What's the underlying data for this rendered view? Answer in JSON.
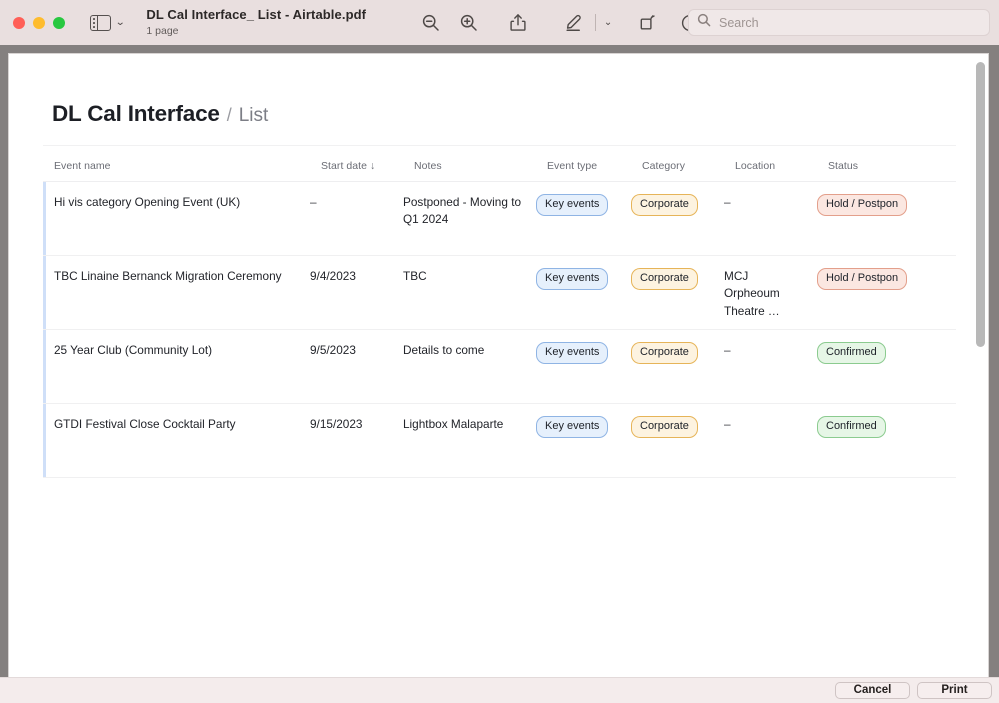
{
  "window": {
    "title": "DL Cal Interface_ List - Airtable.pdf",
    "subtitle": "1 page",
    "traffic_lights": [
      "close-red",
      "minimize-yellow",
      "maximize-green"
    ],
    "sidebar_toggle_icon": "sidebar-icon",
    "sidebar_chevron_icon": "chevron-down-icon"
  },
  "toolbar": {
    "zoom_out_icon": "zoom-out-icon",
    "zoom_in_icon": "zoom-in-icon",
    "share_icon": "share-icon",
    "markup_icon": "markup-pen-icon",
    "markup_chevron_icon": "chevron-down-icon",
    "rotate_icon": "rotate-icon",
    "highlight_icon": "highlight-pen-icon"
  },
  "search": {
    "placeholder": "Search",
    "value": "",
    "icon": "search-icon"
  },
  "document": {
    "breadcrumb": {
      "base": "DL Cal Interface",
      "separator": "/",
      "current": "List"
    },
    "table": {
      "columns": [
        {
          "key": "event_name",
          "label": "Event name"
        },
        {
          "key": "start_date",
          "label": "Start date ↓"
        },
        {
          "key": "notes",
          "label": "Notes"
        },
        {
          "key": "event_type",
          "label": "Event type"
        },
        {
          "key": "category",
          "label": "Category"
        },
        {
          "key": "location",
          "label": "Location"
        },
        {
          "key": "status",
          "label": "Status"
        }
      ],
      "sort_column": "Start date",
      "sort_direction": "descending",
      "rows": [
        {
          "event_name": "Hi vis category Opening Event (UK)",
          "start_date": "–",
          "notes": "Postponed - Moving to Q1 2024",
          "event_type": "Key events",
          "category": "Corporate",
          "location": "–",
          "status": "Hold / Postpon"
        },
        {
          "event_name": "TBC Linaine Bernanck Migration Ceremony",
          "start_date": "9/4/2023",
          "notes": "TBC",
          "event_type": "Key events",
          "category": "Corporate",
          "location": "MCJ Orpheoum Theatre …",
          "status": "Hold / Postpon"
        },
        {
          "event_name": "25 Year Club (Community Lot)",
          "start_date": "9/5/2023",
          "notes": "Details to come",
          "event_type": "Key events",
          "category": "Corporate",
          "location": "–",
          "status": "Confirmed"
        },
        {
          "event_name": "GTDI Festival Close Cocktail Party",
          "start_date": "9/15/2023",
          "notes": "Lightbox Malaparte",
          "event_type": "Key events",
          "category": "Corporate",
          "location": "–",
          "status": "Confirmed"
        }
      ]
    }
  },
  "footer": {
    "cancel_label": "Cancel",
    "print_label": "Print"
  },
  "colors": {
    "badge_blue": "#e6f0fc",
    "badge_blue_border": "#8fb4e4",
    "badge_orange": "#fdf3e0",
    "badge_orange_border": "#e6b458",
    "badge_red": "#fbe7e1",
    "badge_red_border": "#e39f8b",
    "badge_green": "#e6f6e6",
    "badge_green_border": "#8bcb8f",
    "row_accent": "#cfdff8",
    "titlebar": "#e9dfdf",
    "doc_backdrop": "#84807f"
  }
}
